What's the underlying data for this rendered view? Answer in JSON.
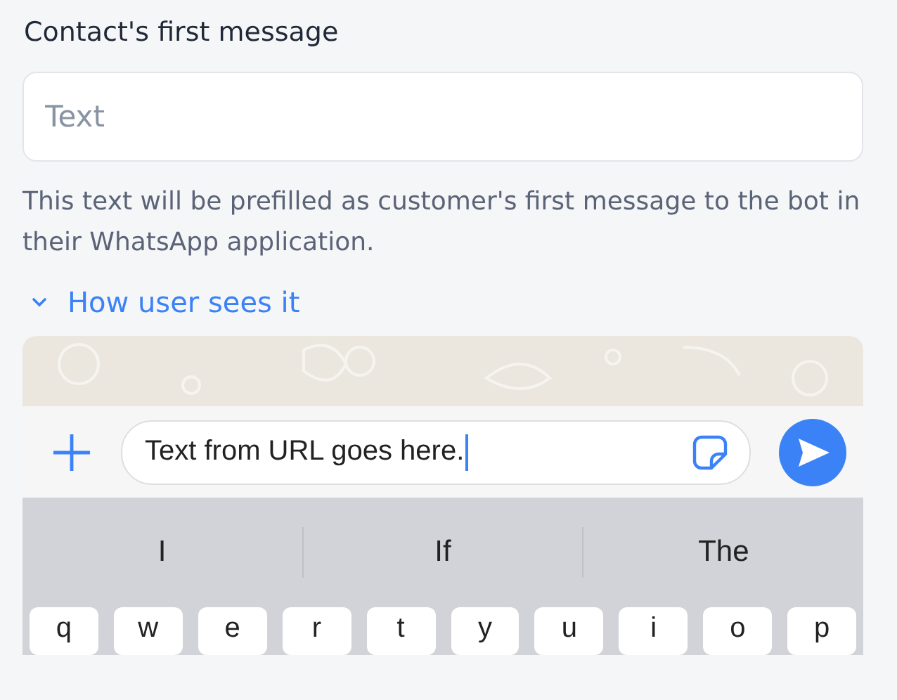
{
  "field": {
    "label": "Contact's first message",
    "placeholder": "Text",
    "help": "This text will be prefilled as customer's first message to the bot in their WhatsApp application."
  },
  "preview_toggle": {
    "label": "How user sees it",
    "expanded": true
  },
  "preview": {
    "message_input": {
      "value": "Text from URL goes here."
    },
    "suggestions": [
      "I",
      "If",
      "The"
    ],
    "keys": [
      "q",
      "w",
      "e",
      "r",
      "t",
      "y",
      "u",
      "i",
      "o",
      "p"
    ]
  }
}
